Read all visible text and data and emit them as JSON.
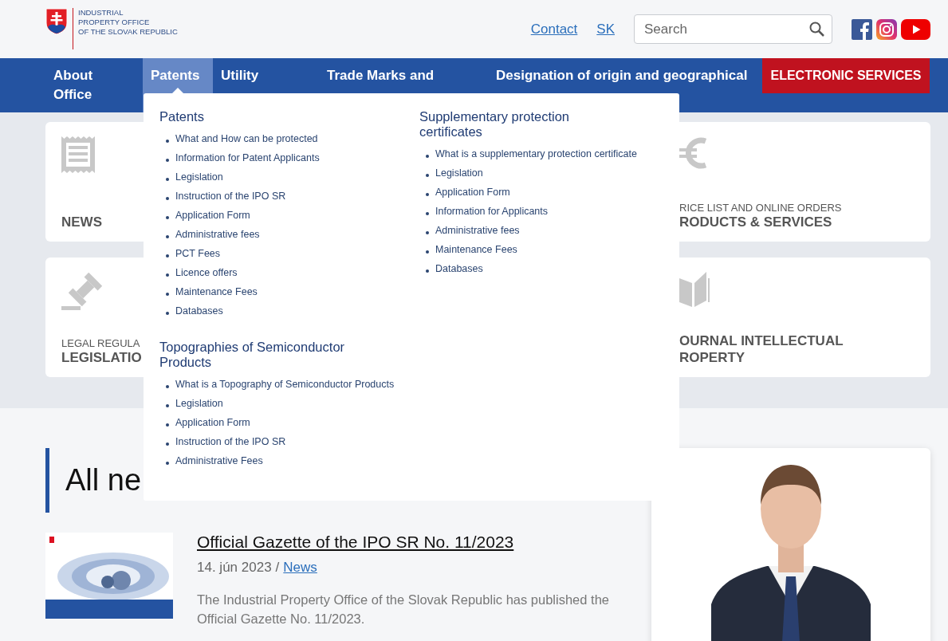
{
  "header": {
    "logo_lines": [
      "INDUSTRIAL",
      "PROPERTY OFFICE",
      "OF THE SLOVAK REPUBLIC"
    ],
    "links": [
      "Contact",
      "SK"
    ],
    "search": {
      "placeholder": "Search"
    },
    "social": [
      {
        "kind": "facebook"
      },
      {
        "kind": "instagram"
      },
      {
        "kind": "youtube"
      }
    ]
  },
  "nav": {
    "items": [
      {
        "label_lines": [
          "About",
          "Office"
        ],
        "selected": false
      },
      {
        "label_lines": [
          "Patents"
        ],
        "selected": true
      },
      {
        "label_lines": [
          "Utility"
        ],
        "selected": false
      },
      {
        "label_lines": [
          "Trade Marks and"
        ],
        "selected": false
      },
      {
        "label_lines": [
          "Designation of origin and geographical"
        ],
        "selected": false
      }
    ],
    "cta": "ELECTRONIC SERVICES"
  },
  "dropdown": {
    "columns": [
      {
        "sections": [
          {
            "title": "Patents",
            "links": [
              "What and How can be protected",
              "Information for Patent Applicants",
              "Legislation",
              "Instruction of the IPO SR",
              "Application Form",
              "Administrative fees",
              "PCT Fees",
              "Licence offers",
              "Maintenance Fees",
              "Databases"
            ]
          },
          {
            "title": "Topographies of Semiconductor Products",
            "links": [
              "What is a Topography of Semiconductor Products",
              "Legislation",
              "Application Form",
              "Instruction of the IPO SR",
              "Administrative Fees"
            ]
          }
        ]
      },
      {
        "sections": [
          {
            "title": "Supplementary protection certificates",
            "links": [
              "What is a supplementary protection certificate",
              "Legislation",
              "Application Form",
              "Information for Applicants",
              "Administrative fees",
              "Maintenance Fees",
              "Databases"
            ]
          }
        ]
      }
    ]
  },
  "tile_rows": [
    {
      "tiles": [
        {
          "kind": "news",
          "title_lines": [
            "NEWS"
          ]
        },
        {
          "kind": "price",
          "subtitle": "RICE LIST AND ONLINE ORDERS",
          "title_lines": [
            "RODUCTS & SERVICES"
          ]
        }
      ]
    },
    {
      "tiles": [
        {
          "kind": "legal",
          "subtitle": "LEGAL REGULA",
          "title_lines": [
            "LEGISLATIO"
          ]
        },
        {
          "kind": "journal",
          "title_lines": [
            "OURNAL INTELLECTUAL",
            "ROPERTY"
          ]
        }
      ]
    }
  ],
  "news": {
    "heading": "All ne",
    "items": [
      {
        "title": "Official Gazette of the IPO SR No. 11/2023",
        "date": "14. jún 2023",
        "separator": "/",
        "category": "News",
        "summary": "The Industrial Property Office of the Slovak Republic has published the Official Gazette No. 11/2023."
      }
    ]
  }
}
